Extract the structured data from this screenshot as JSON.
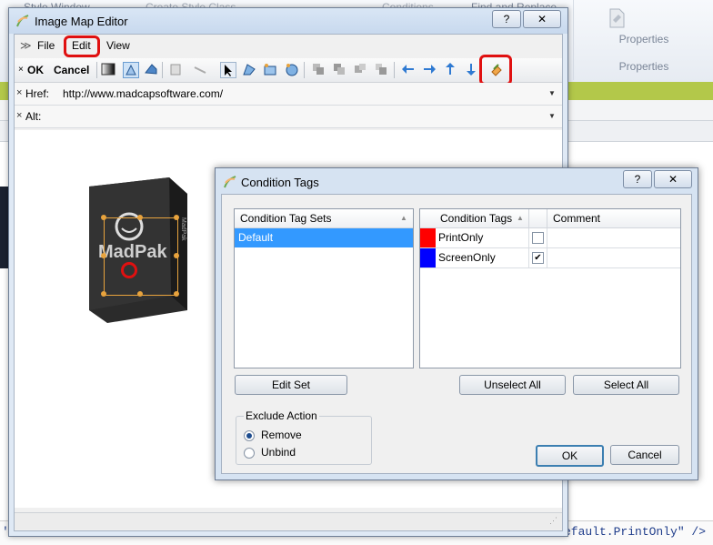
{
  "background_app": {
    "ribbon_items": [
      "Style Window",
      "Create Style Class",
      "Conditions",
      "Find and Replace"
    ],
    "properties_labels": [
      "Properties",
      "Properties"
    ],
    "code_line_left": "'",
    "code_line_right": "efault.PrintOnly\" />"
  },
  "image_map_editor": {
    "title": "Image Map Editor",
    "window_buttons": [
      "?",
      "✕"
    ],
    "menu": [
      "File",
      "Edit",
      "View"
    ],
    "toolbar": {
      "ok_label": "OK",
      "cancel_label": "Cancel"
    },
    "href": {
      "label": "Href:",
      "value": "http://www.madcapsoftware.com/"
    },
    "alt": {
      "label": "Alt:",
      "value": ""
    },
    "image_text": {
      "brand": "MadPak",
      "side": "MadPak"
    }
  },
  "condition_tags_dialog": {
    "title": "Condition Tags",
    "window_buttons": [
      "?",
      "✕"
    ],
    "sets_header": "Condition Tag Sets",
    "sets": [
      "Default"
    ],
    "tags_headers": {
      "name": "Condition Tags",
      "comment": "Comment"
    },
    "tags": [
      {
        "name": "PrintOnly",
        "color": "#ff0000",
        "checked": false,
        "comment": ""
      },
      {
        "name": "ScreenOnly",
        "color": "#0000ff",
        "checked": true,
        "comment": ""
      }
    ],
    "buttons": {
      "edit_set": "Edit Set",
      "unselect_all": "Unselect All",
      "select_all": "Select All",
      "ok": "OK",
      "cancel": "Cancel"
    },
    "exclude_action": {
      "label": "Exclude Action",
      "options": [
        "Remove",
        "Unbind"
      ],
      "selected": "Remove"
    }
  }
}
